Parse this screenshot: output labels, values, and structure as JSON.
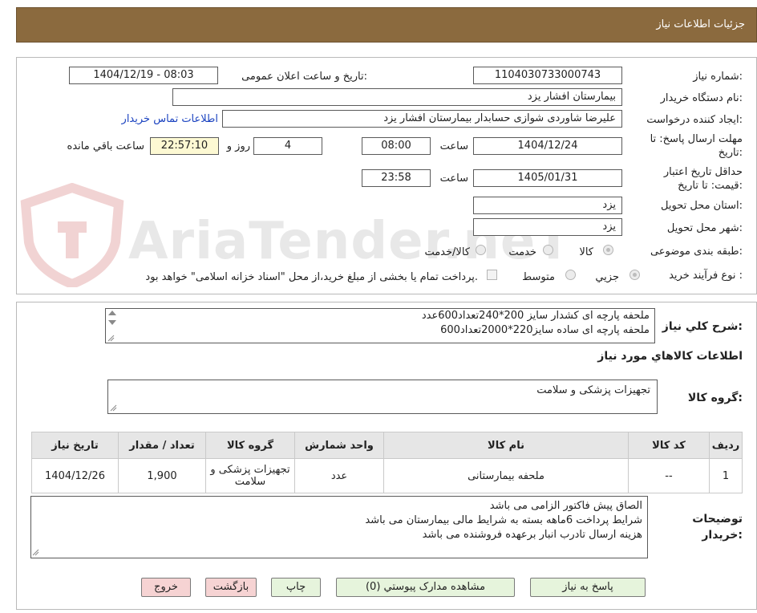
{
  "header": {
    "title": "جزئیات اطلاعات نیاز"
  },
  "watermark": {
    "text": "AriaTender.neT"
  },
  "fields": {
    "need_number_label": "شماره نیاز:",
    "need_number": "1104030733000743",
    "announce_label": "تاریخ و ساعت اعلان عمومی:",
    "announce_value": "1404/12/19 - 08:03",
    "buyer_org_label": "نام دستگاه خریدار:",
    "buyer_org": "بیمارستان افشار یزد",
    "creator_label": "ایجاد کننده درخواست:",
    "creator": "علیرضا شاوردی شوازی حسابدار بیمارستان افشار یزد",
    "contact_link": "اطلاعات تماس خریدار",
    "send_deadline_label": "مهلت ارسال پاسخ: تا تاریخ:",
    "send_date": "1404/12/24",
    "time_label": "ساعت",
    "send_time": "08:00",
    "days_value": "4",
    "days_label": "روز و",
    "countdown": "22:57:10",
    "remaining_label": "ساعت باقي مانده",
    "validity_label": "حداقل تاریخ اعتبار قیمت: تا تاریخ:",
    "validity_date": "1405/01/31",
    "validity_time": "23:58",
    "province_label": "استان محل تحویل:",
    "province": "یزد",
    "city_label": "شهر محل تحویل:",
    "city": "یزد",
    "category_label": "طبقه بندی موضوعی:",
    "category_options": [
      "کالا",
      "خدمت",
      "کالا/خدمت"
    ],
    "purchase_type_label": "نوع فرآیند خرید :",
    "purchase_options": [
      "جزیي",
      "متوسط"
    ],
    "purchase_note": "پرداخت تمام یا بخشی از مبلغ خرید،از محل \"اسناد خزانه اسلامی\" خواهد بود."
  },
  "summary": {
    "label": "شرح کلي نياز:",
    "lines": [
      "ملحفه  پارچه ای کشدار  سایز 200*240تعداد600عدد",
      "ملحفه پارچه ای ساده سایز220*2000تعداد600"
    ]
  },
  "goods_section": {
    "title": "اطلاعات کالاهاي مورد نياز",
    "group_label": "گروه کالا:",
    "group_value": "تجهیزات پزشکی و سلامت"
  },
  "table": {
    "headers": [
      "ردیف",
      "کد کالا",
      "نام کالا",
      "واحد شمارش",
      "گروه کالا",
      "تعداد / مقدار",
      "تاریخ نیاز"
    ],
    "rows": [
      [
        "1",
        "--",
        "ملحفه بیمارستانی",
        "عدد",
        "تجهیزات پزشکی و سلامت",
        "1,900",
        "1404/12/26"
      ]
    ]
  },
  "notes": {
    "label": "توضیحات خریدار:",
    "lines": [
      "الصاق پیش فاکتور الزامی می باشد",
      "شرایط پرداخت 6ماهه بسته به شرایط مالی بیمارستان می باشد",
      "هزینه ارسال تادرب انبار برعهده فروشنده می باشد"
    ]
  },
  "buttons": {
    "reply": "پاسخ به نياز",
    "attachments": "مشاهده مدارک پیوستي (0)",
    "print": "چاپ",
    "back": "بازگشت",
    "exit": "خروج"
  },
  "colors": {
    "header_bg": "#8b6a3e",
    "link": "#1b43c0",
    "timer_bg": "#fdf9d3",
    "btn_green": "#e6f4dc",
    "btn_red": "#f6d3d3"
  }
}
